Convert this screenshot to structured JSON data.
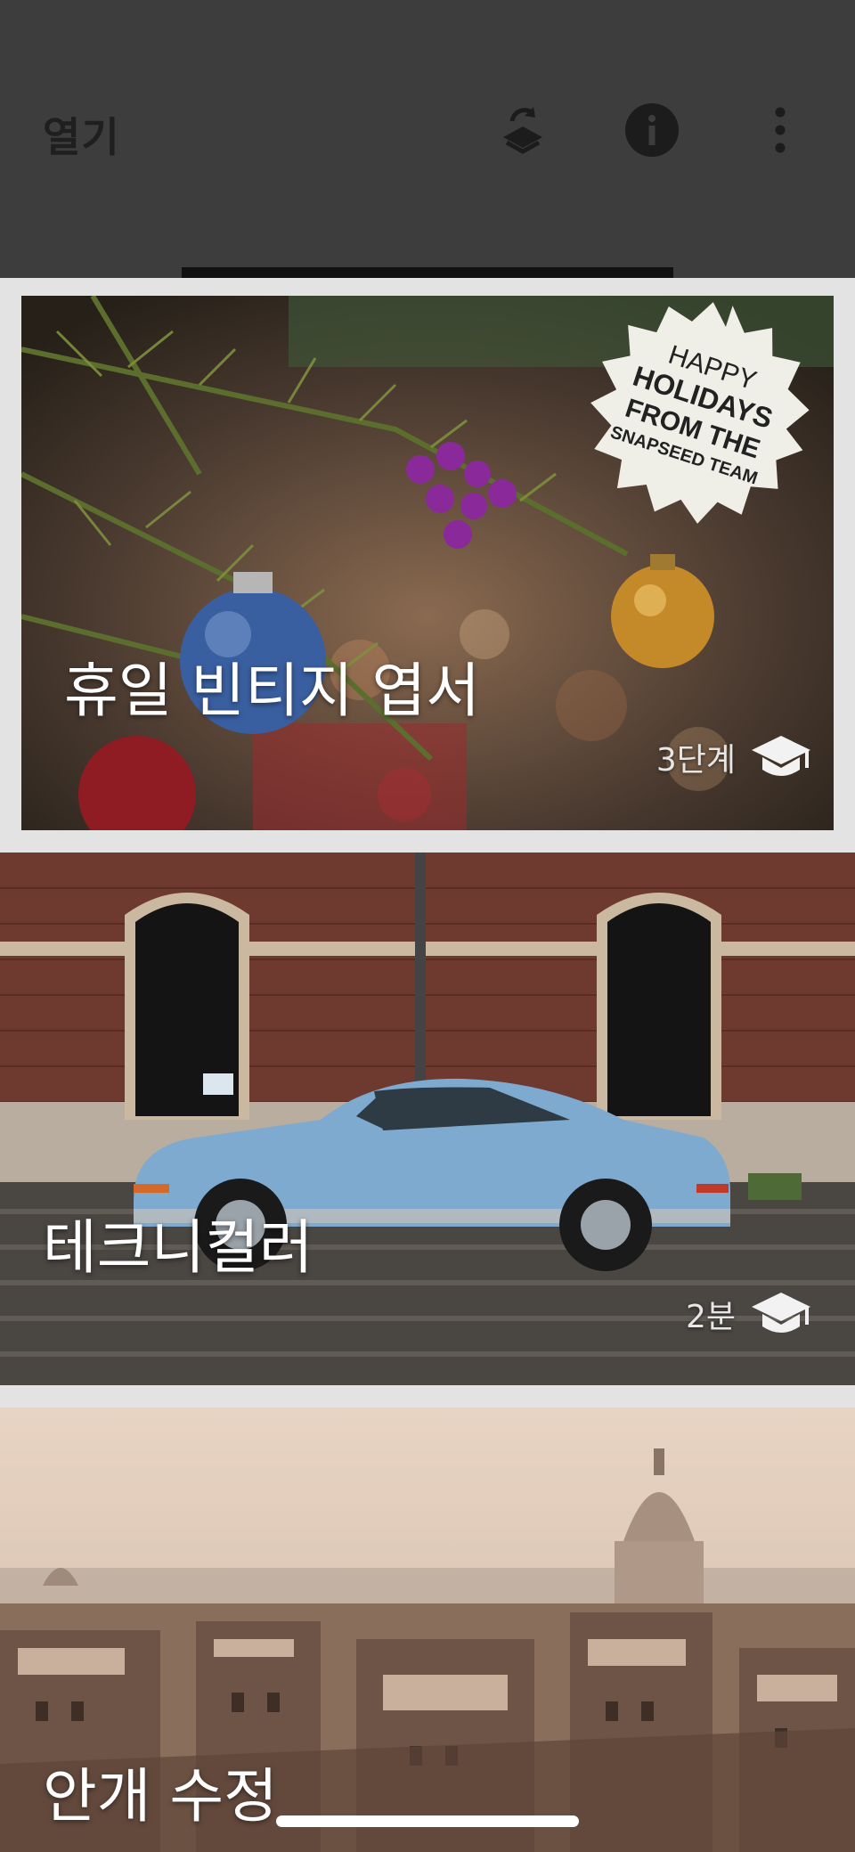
{
  "header": {
    "title": "열기",
    "icons": [
      "layers-icon",
      "info-icon",
      "more-vert-icon"
    ]
  },
  "cards": [
    {
      "title": "휴일 빈티지 엽서",
      "meta": "3단계",
      "badge": {
        "line1": "HAPPY",
        "line2": "HOLIDAYS",
        "line3": "FROM THE",
        "line4": "SNAPSEED TEAM"
      }
    },
    {
      "title": "테크니컬러",
      "meta": "2분"
    },
    {
      "title": "안개 수정"
    }
  ],
  "colors": {
    "topbar": "#3d3d3d",
    "background": "#e3e3e3",
    "text": "#ffffff"
  }
}
